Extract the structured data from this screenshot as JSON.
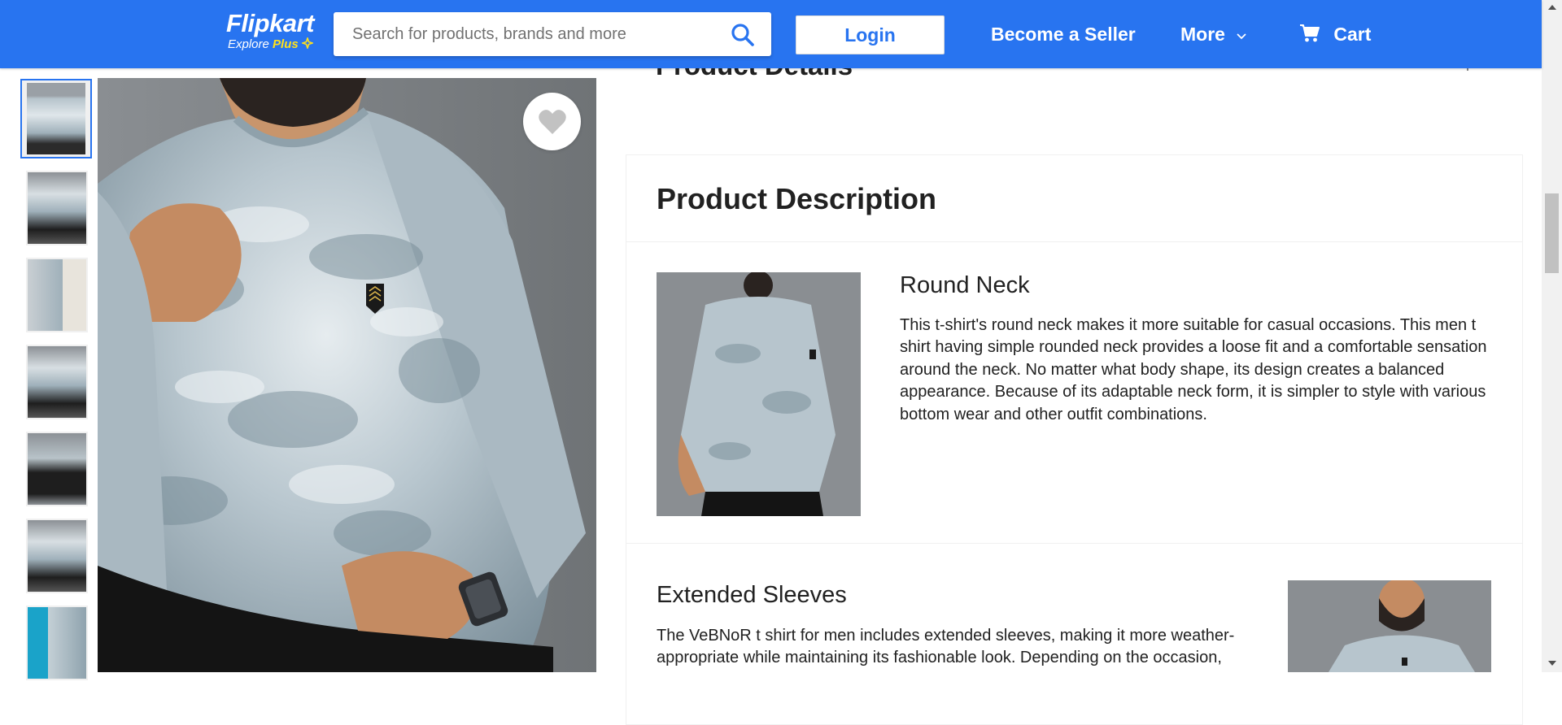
{
  "header": {
    "logo_title": "Flipkart",
    "logo_explore": "Explore",
    "logo_plus": "Plus",
    "search_placeholder": "Search for products, brands and more",
    "login_label": "Login",
    "seller_label": "Become a Seller",
    "more_label": "More",
    "cart_label": "Cart",
    "brand_color": "#2874f0"
  },
  "gallery": {
    "thumbnail_count": 7,
    "active_index": 0,
    "wishlist_icon": "heart-icon"
  },
  "product": {
    "details_title": "Product Details",
    "description_title": "Product Description",
    "features": [
      {
        "title": "Round Neck",
        "text": "This t-shirt's round neck makes it more suitable for casual occasions. This men t shirt having simple rounded neck provides a loose fit and a comfortable sensation around the neck. No matter what body shape, its design creates a balanced appearance. Because of its adaptable neck form, it is simpler to style with various bottom wear and other outfit combinations."
      },
      {
        "title": "Extended Sleeves",
        "text": "The VeBNoR t shirt for men includes extended sleeves, making it more weather-appropriate while maintaining its fashionable look. Depending on the occasion,"
      }
    ]
  }
}
